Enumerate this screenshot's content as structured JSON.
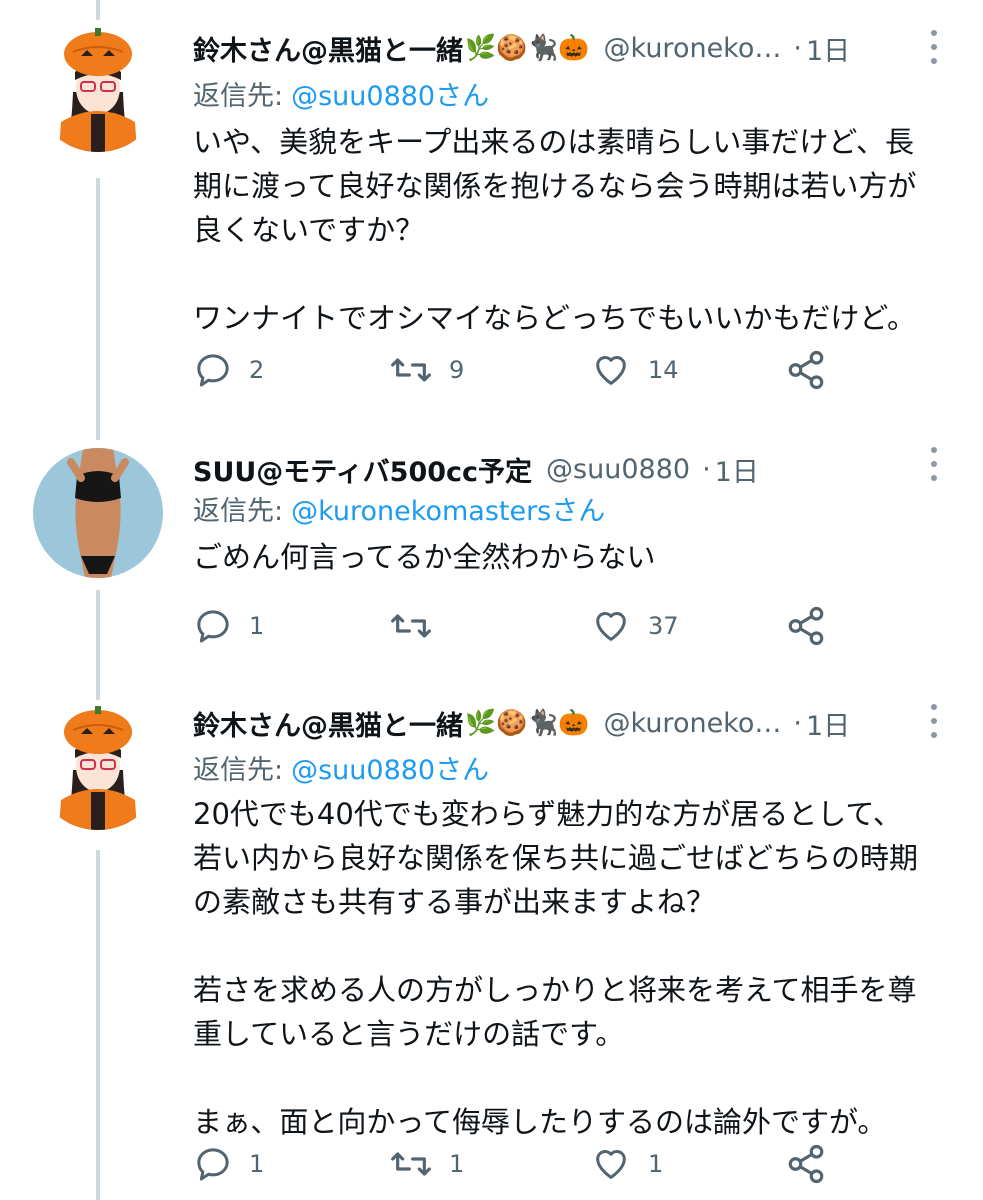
{
  "tweets": [
    {
      "author_name": "鈴木さん@黒猫と一緒",
      "emoji": "🌿🍪🐈‍⬛🎃",
      "handle": "@kuroneko…",
      "separator": "·",
      "time": "1日",
      "reply_label": "返信先:",
      "reply_mention": "@suu0880さん",
      "body_lines": [
        "いや、美貌をキープ出来るのは素晴らしい事だけど、長",
        "期に渡って良好な関係を抱けるなら会う時期は若い方が",
        "良くないですか？",
        "",
        "ワンナイトでオシマイならどっちでもいいかもだけど。"
      ],
      "replies": "2",
      "retweets": "9",
      "likes": "14"
    },
    {
      "author_name": "SUU@モティバ500cc予定",
      "emoji": "",
      "handle": "@suu0880",
      "separator": "·",
      "time": "1日",
      "reply_label": "返信先:",
      "reply_mention": "@kuronekomastersさん",
      "body_lines": [
        "ごめん何言ってるか全然わからない"
      ],
      "replies": "1",
      "retweets": "",
      "likes": "37"
    },
    {
      "author_name": "鈴木さん@黒猫と一緒",
      "emoji": "🌿🍪🐈‍⬛🎃",
      "handle": "@kuroneko…",
      "separator": "·",
      "time": "1日",
      "reply_label": "返信先:",
      "reply_mention": "@suu0880さん",
      "body_lines": [
        "20代でも40代でも変わらず魅力的な方が居るとして、",
        "若い内から良好な関係を保ち共に過ごせばどちらの時期",
        "の素敵さも共有する事が出来ますよね？",
        "",
        "若さを求める人の方がしっかりと将来を考えて相手を尊",
        "重していると言うだけの話です。",
        "",
        "まぁ、面と向かって侮辱したりするのは論外ですが。"
      ],
      "replies": "1",
      "retweets": "1",
      "likes": "1"
    }
  ],
  "colors": {
    "text": "#0f1419",
    "secondary": "#536471",
    "link": "#1d9bf0",
    "thread_line": "#cfd9de"
  }
}
